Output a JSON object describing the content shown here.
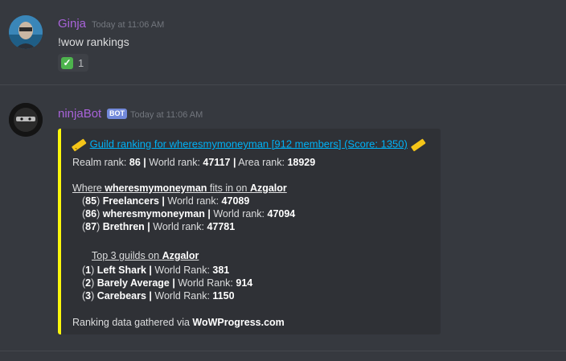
{
  "messages": [
    {
      "username": "Ginja",
      "username_color": "#a863d9",
      "timestamp": "Today at 11:06 AM",
      "text": "!wow rankings",
      "reaction": {
        "icon": "check-mark-icon",
        "count": "1"
      }
    },
    {
      "username": "ninjaBot",
      "username_color": "#a863d9",
      "bot_tag": "BOT",
      "timestamp": "Today at 11:06 AM",
      "embed": {
        "border_color": "#faf60c",
        "title": "Guild ranking for wheresmymoneyman [912 members] (Score: 1350)",
        "ranks": {
          "realm_label": "Realm rank:",
          "realm_value": "86",
          "world_label": "World rank:",
          "world_value": "47117",
          "area_label": "Area rank:",
          "area_value": "18929"
        },
        "fits": {
          "prefix": "Where ",
          "guild": "wheresmymoneyman",
          "middle": " fits in on ",
          "realm": "Azgalor",
          "rows": [
            {
              "pos": "85",
              "name": "Freelancers",
              "label": "World rank:",
              "value": "47089"
            },
            {
              "pos": "86",
              "name": "wheresmymoneyman",
              "label": "World rank:",
              "value": "47094"
            },
            {
              "pos": "87",
              "name": "Brethren",
              "label": "World rank:",
              "value": "47781"
            }
          ]
        },
        "top3": {
          "prefix": "Top 3 guilds on ",
          "realm": "Azgalor",
          "rows": [
            {
              "pos": "1",
              "name": "Left Shark",
              "label": "World Rank:",
              "value": "381"
            },
            {
              "pos": "2",
              "name": "Barely Average",
              "label": "World Rank:",
              "value": "914"
            },
            {
              "pos": "3",
              "name": "Carebears",
              "label": "World Rank:",
              "value": "1150"
            }
          ]
        },
        "footer_prefix": "Ranking data gathered via ",
        "footer_source": "WoWProgress.com"
      }
    }
  ]
}
